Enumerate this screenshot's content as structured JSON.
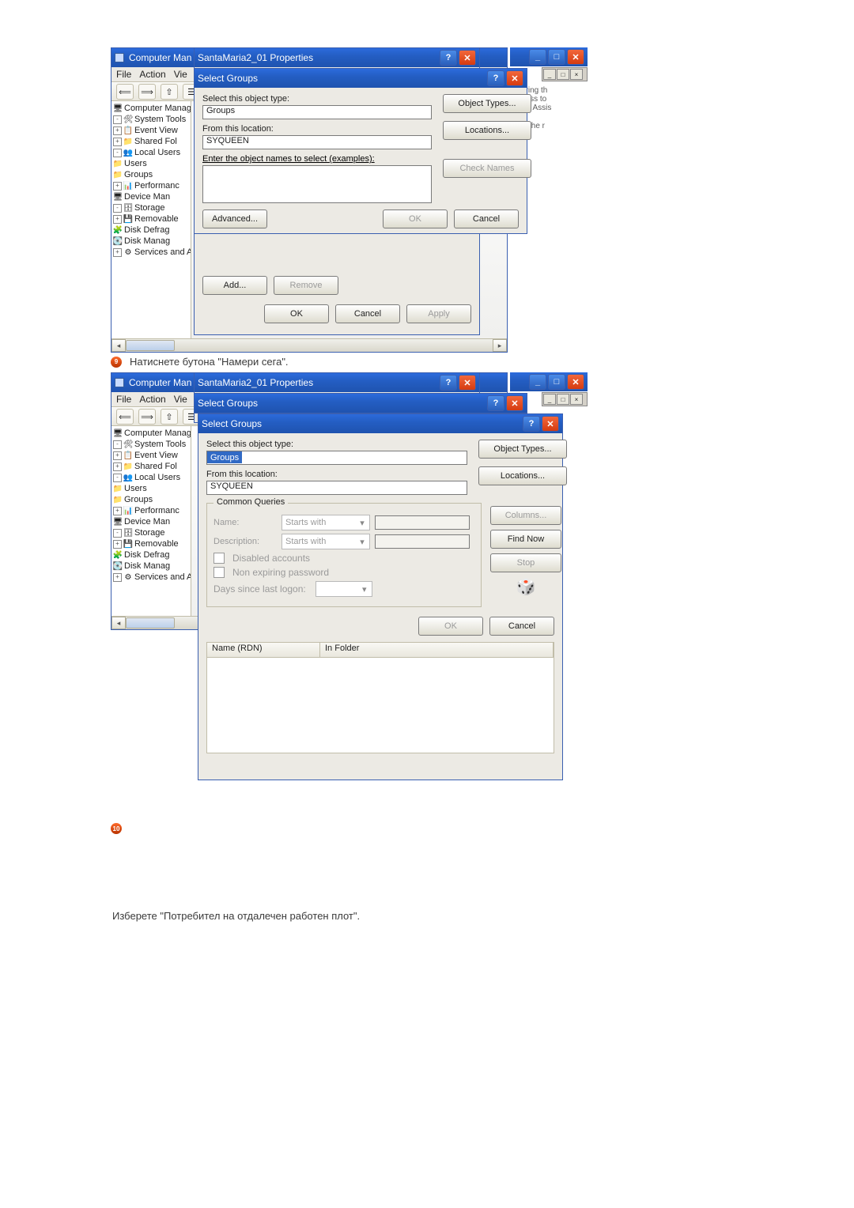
{
  "shared": {
    "cm_title": "Computer Man",
    "props_title": "SantaMaria2_01 Properties",
    "select_groups_title": "Select Groups",
    "menu": {
      "file": "File",
      "action": "Action",
      "view": "Vie"
    },
    "toolbar_icons": {
      "back": "⟸",
      "fwd": "⟹",
      "up": "⇧",
      "props": "☰"
    },
    "tree": {
      "root": "Computer Manager",
      "sys": "System Tools",
      "evt": "Event View",
      "shf": "Shared Fol",
      "loc": "Local Users",
      "usr": "Users",
      "grp": "Groups",
      "perf": "Performanc",
      "dev": "Device Man",
      "stor": "Storage",
      "rem": "Removable",
      "defrag": "Disk Defrag",
      "diskm": "Disk Manag",
      "svc": "Services and A"
    },
    "sel_object_type": "Select this object type:",
    "groups": "Groups",
    "from_loc": "From this location:",
    "location_value": "SYQUEEN",
    "enter_names": "Enter the object names to select (examples):",
    "object_types_btn": "Object Types...",
    "locations_btn": "Locations...",
    "check_names_btn": "Check Names",
    "advanced_btn": "Advanced...",
    "ok": "OK",
    "cancel": "Cancel",
    "apply": "Apply",
    "add": "Add...",
    "remove": "Remove",
    "right_strip": {
      "l1": "istering th",
      "l2": "access to",
      "l3": "mote Assis",
      "gap": "",
      "l4": "t for the r"
    }
  },
  "step9": {
    "text": "Натиснете бутона \"Намери сега\"."
  },
  "shot2": {
    "common_queries": "Common Queries",
    "name_lbl": "Name:",
    "desc_lbl": "Description:",
    "starts_with": "Starts with",
    "disabled_accounts": "Disabled accounts",
    "non_expiring": "Non expiring password",
    "days_since": "Days since last logon:",
    "columns_btn": "Columns...",
    "find_now_btn": "Find Now",
    "stop_btn": "Stop",
    "name_rdn": "Name (RDN)",
    "in_folder": "In Folder"
  },
  "step10": {
    "text": "Изберете \"Потребител на отдалечен работен плот\"."
  }
}
